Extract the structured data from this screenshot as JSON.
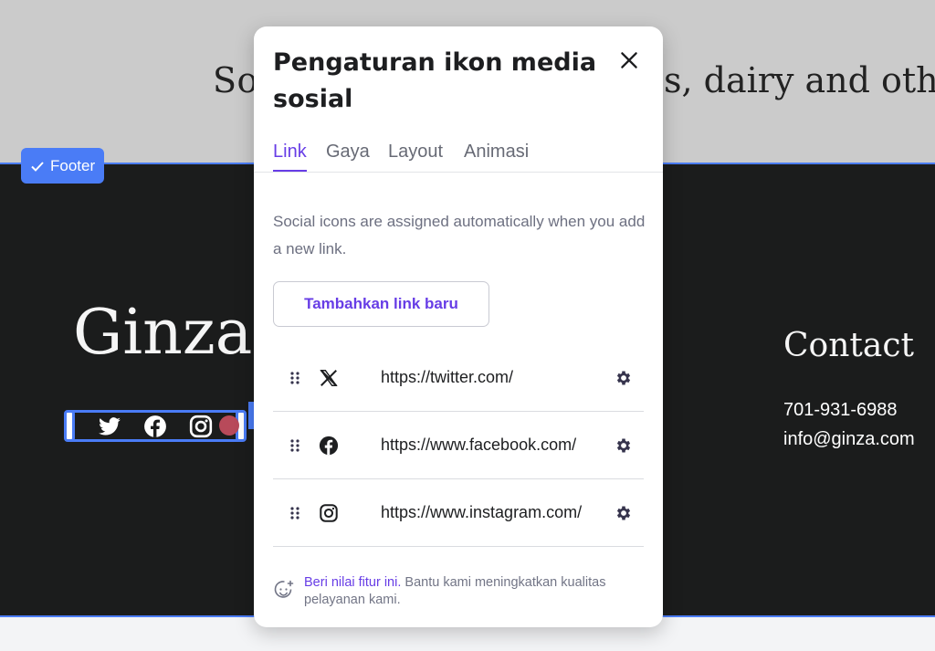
{
  "page": {
    "hero_left": "So",
    "hero_right": "s, dairy and other",
    "footer_badge": "Footer",
    "brand": "Ginza",
    "contact_title": "Contact",
    "phone": "701-931-6988",
    "email": "info@ginza.com"
  },
  "modal": {
    "title": "Pengaturan ikon media sosial",
    "tabs": [
      {
        "label": "Link"
      },
      {
        "label": "Gaya"
      },
      {
        "label": "Layout"
      },
      {
        "label": "Animasi"
      }
    ],
    "description": "Social icons are assigned automatically when you add a new link.",
    "add_button": "Tambahkan link baru",
    "links": [
      {
        "icon": "x-twitter-icon",
        "url": "https://twitter.com/"
      },
      {
        "icon": "facebook-icon",
        "url": "https://www.facebook.com/"
      },
      {
        "icon": "instagram-icon",
        "url": "https://www.instagram.com/"
      }
    ],
    "feedback_link": "Beri nilai fitur ini.",
    "feedback_text": " Bantu kami meningkatkan kualitas pelayanan kami."
  },
  "colors": {
    "accent": "#673de6",
    "selection_blue": "#4a7cf6",
    "footer_bg": "#1b1c1c",
    "top_bg": "#cbcbcb"
  }
}
